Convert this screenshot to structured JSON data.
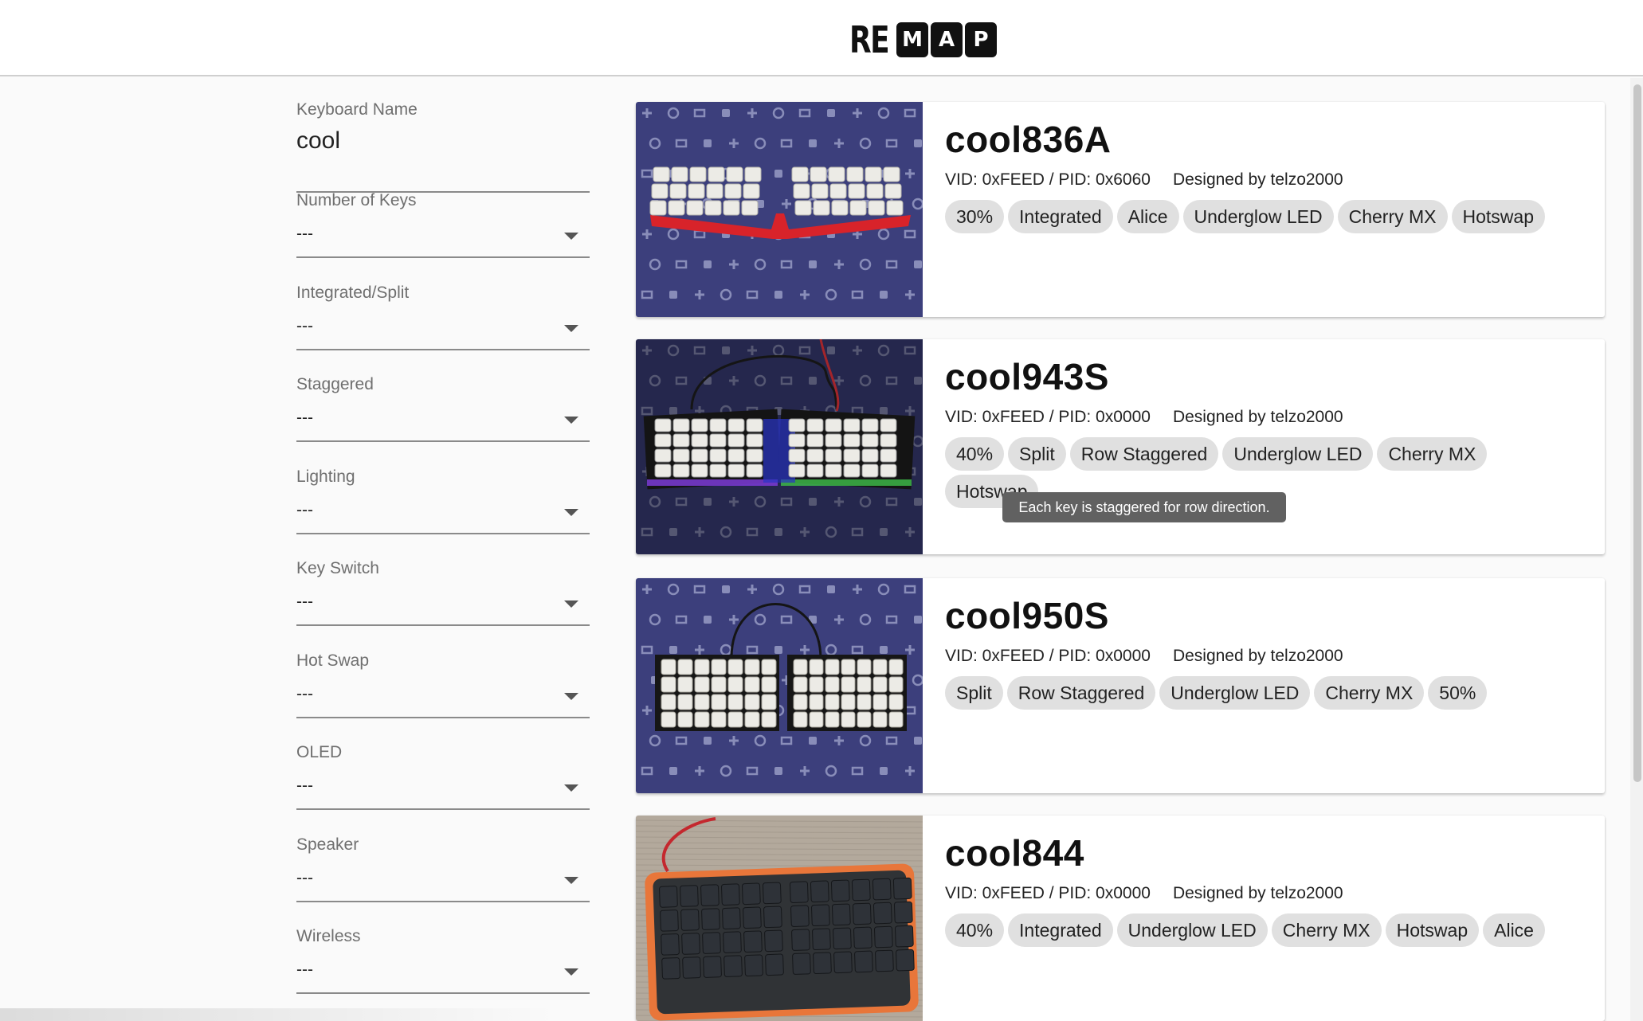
{
  "header": {
    "logo_plain": "RE",
    "logo_boxes": [
      "M",
      "A",
      "P"
    ]
  },
  "filters": {
    "keyboard_name": {
      "label": "Keyboard Name",
      "value": "cool"
    },
    "selects": [
      {
        "label": "Number of Keys",
        "value": "---"
      },
      {
        "label": "Integrated/Split",
        "value": "---"
      },
      {
        "label": "Staggered",
        "value": "---"
      },
      {
        "label": "Lighting",
        "value": "---"
      },
      {
        "label": "Key Switch",
        "value": "---"
      },
      {
        "label": "Hot Swap",
        "value": "---"
      },
      {
        "label": "OLED",
        "value": "---"
      },
      {
        "label": "Speaker",
        "value": "---"
      },
      {
        "label": "Wireless",
        "value": "---"
      }
    ]
  },
  "keyboards": [
    {
      "name": "cool836A",
      "ids": "VID: 0xFEED / PID: 0x6060",
      "designer": "Designed by telzo2000",
      "tags": [
        "30%",
        "Integrated",
        "Alice",
        "Underglow LED",
        "Cherry MX",
        "Hotswap"
      ]
    },
    {
      "name": "cool943S",
      "ids": "VID: 0xFEED / PID: 0x0000",
      "designer": "Designed by telzo2000",
      "tags": [
        "40%",
        "Split",
        "Row Staggered",
        "Underglow LED",
        "Cherry MX",
        "Hotswap"
      ]
    },
    {
      "name": "cool950S",
      "ids": "VID: 0xFEED / PID: 0x0000",
      "designer": "Designed by telzo2000",
      "tags": [
        "Split",
        "Row Staggered",
        "Underglow LED",
        "Cherry MX",
        "50%"
      ]
    },
    {
      "name": "cool844",
      "ids": "VID: 0xFEED / PID: 0x0000",
      "designer": "Designed by telzo2000",
      "tags": [
        "40%",
        "Integrated",
        "Underglow LED",
        "Cherry MX",
        "Hotswap",
        "Alice"
      ]
    }
  ],
  "tooltip": "Each key is staggered for row direction.",
  "colors": {
    "mat_blue": "#3c3f7c",
    "mat_blue_dark": "#2a2c5e",
    "keycap": "#ecebe6",
    "case_red": "#d8232a",
    "carpet": "#b3a99c",
    "case_orange": "#e8763a",
    "keycap_dark": "#2e3238"
  }
}
